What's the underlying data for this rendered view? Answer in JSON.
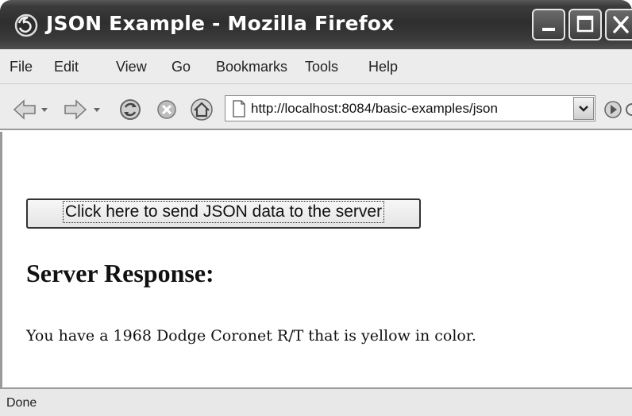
{
  "window": {
    "title": "JSON Example - Mozilla Firefox"
  },
  "menu": {
    "items": [
      {
        "label": "File"
      },
      {
        "label": "Edit"
      },
      {
        "label": "View"
      },
      {
        "label": "Go"
      },
      {
        "label": "Bookmarks"
      },
      {
        "label": "Tools"
      },
      {
        "label": "Help"
      }
    ]
  },
  "toolbar": {
    "icons": [
      "back-icon",
      "forward-icon",
      "reload-icon",
      "stop-icon",
      "home-icon",
      "page-icon",
      "go-icon"
    ],
    "url": "http://localhost:8084/basic-examples/json"
  },
  "content": {
    "send_button_label": "Click here to send JSON data to the server",
    "heading": "Server Response:",
    "response": "You have a 1968 Dodge Coronet R/T that is yellow in color."
  },
  "status": {
    "text": "Done"
  }
}
